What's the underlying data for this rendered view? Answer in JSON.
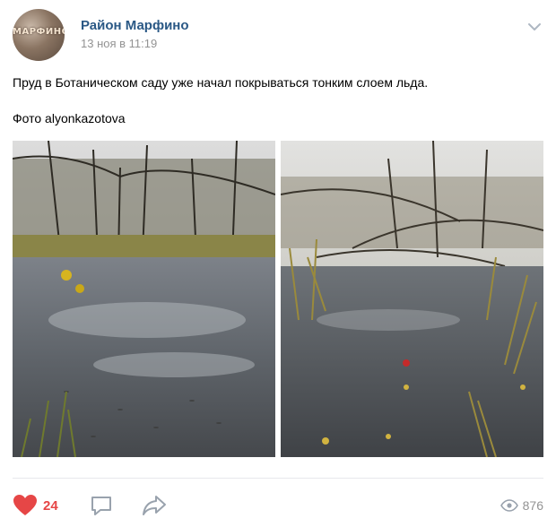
{
  "post": {
    "author": "Район Марфино",
    "date": "13 ноя в 11:19",
    "avatar_text": "МАРФИНО",
    "text": "Пруд в Ботаническом саду уже начал покрываться тонким слоем льда.\n\nФото alyonkazotova",
    "icons": {
      "menu": "chevron-down-icon",
      "like": "heart-icon",
      "comment": "comment-icon",
      "share": "share-icon",
      "views": "eye-icon"
    }
  },
  "actions": {
    "likes": "24",
    "views": "876"
  },
  "colors": {
    "link": "#2a5885",
    "like": "#e64646",
    "muted": "#939393",
    "icon": "#99a2ad"
  }
}
